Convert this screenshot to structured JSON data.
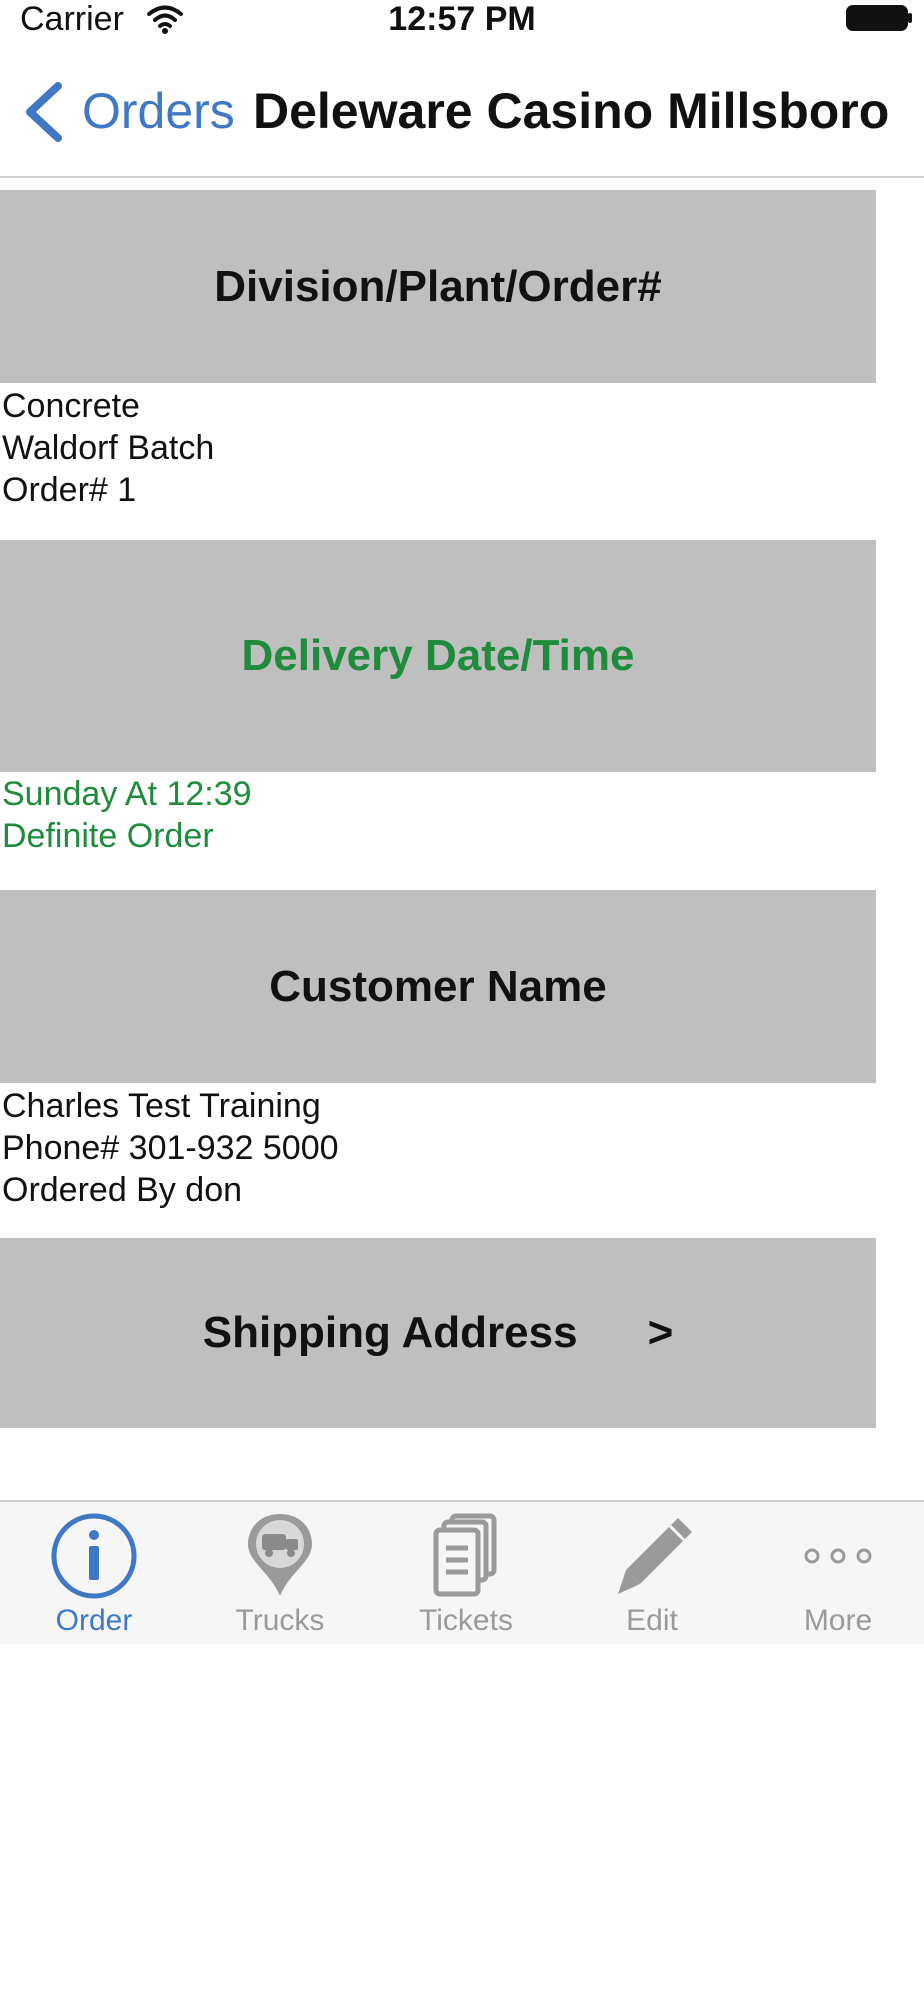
{
  "status_bar": {
    "carrier": "Carrier",
    "time": "12:57 PM"
  },
  "nav": {
    "back_label": "Orders",
    "title": "Deleware Casino Millsboro"
  },
  "sections": {
    "division": {
      "header": "Division/Plant/Order#",
      "lines": [
        "Concrete",
        "Waldorf Batch",
        "Order# 1"
      ]
    },
    "delivery": {
      "header": "Delivery Date/Time",
      "lines": [
        "Sunday At 12:39",
        "Definite Order"
      ]
    },
    "customer": {
      "header": "Customer Name",
      "lines": [
        "Charles Test Training",
        "Phone# 301-932 5000",
        "Ordered By don"
      ]
    },
    "shipping": {
      "header": "Shipping Address",
      "chevron": ">"
    }
  },
  "tabs": [
    {
      "label": "Order",
      "icon": "info-circle-icon",
      "active": true
    },
    {
      "label": "Trucks",
      "icon": "truck-pin-icon",
      "active": false
    },
    {
      "label": "Tickets",
      "icon": "tickets-stack-icon",
      "active": false
    },
    {
      "label": "Edit",
      "icon": "pencil-icon",
      "active": false
    },
    {
      "label": "More",
      "icon": "more-dots-icon",
      "active": false
    }
  ],
  "colors": {
    "accent": "#3e78c7",
    "green": "#1f8c3d",
    "section_bg": "#bfbfbf",
    "inactive": "#9a9a9a"
  }
}
